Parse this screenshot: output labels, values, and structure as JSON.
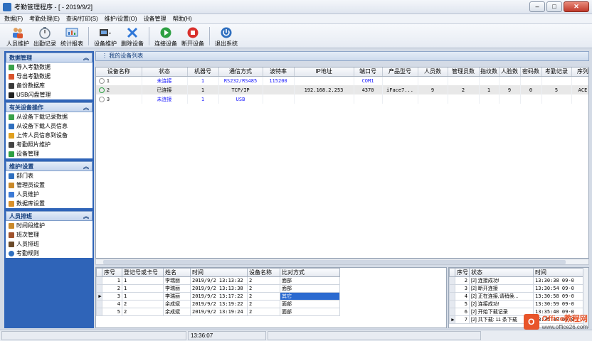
{
  "window": {
    "title": "考勤管理程序 - [ - 2019/9/2]",
    "min": "–",
    "max": "□",
    "close": "✕"
  },
  "menu": [
    "数据(F)",
    "考勤处理(E)",
    "查询/打印(S)",
    "维护/设置(O)",
    "设备管理",
    "帮助(H)"
  ],
  "toolbar": [
    {
      "label": "人员维护",
      "icon": "people-icon",
      "color": "#3c7ad6"
    },
    {
      "label": "出勤记录",
      "icon": "stopwatch-icon",
      "color": "#6b7b8c"
    },
    {
      "label": "统计报表",
      "icon": "report-icon",
      "color": "#2f6fbf"
    },
    {
      "label": "设备维护",
      "icon": "device-icon",
      "color": "#3a3a3a"
    },
    {
      "label": "删除设备",
      "icon": "delete-x-icon",
      "color": "#2f77d8"
    },
    {
      "label": "连接设备",
      "icon": "play-icon",
      "color": "#2ea043"
    },
    {
      "label": "断开设备",
      "icon": "stop-icon",
      "color": "#d9302c"
    },
    {
      "label": "退出系统",
      "icon": "power-icon",
      "color": "#2f6fbf"
    }
  ],
  "sidebar": [
    {
      "title": "数据管理",
      "items": [
        {
          "label": "导入考勤数据",
          "icon": "import-arrow-icon",
          "color": "#3aa14a"
        },
        {
          "label": "导出考勤数据",
          "icon": "export-arrow-icon",
          "color": "#d9542c"
        },
        {
          "label": "备份数据库",
          "icon": "backup-icon",
          "color": "#3a3a3a"
        },
        {
          "label": "USB闪盘管理",
          "icon": "usb-icon",
          "color": "#222"
        }
      ]
    },
    {
      "title": "有关设备操作",
      "items": [
        {
          "label": "从设备下载记录数据",
          "icon": "download-icon",
          "color": "#3aa14a"
        },
        {
          "label": "从设备下载人员信息",
          "icon": "download-people-icon",
          "color": "#2f6fbf"
        },
        {
          "label": "上传人员信息到设备",
          "icon": "upload-icon",
          "color": "#e0a020"
        },
        {
          "label": "考勤照片维护",
          "icon": "photo-icon",
          "color": "#444"
        },
        {
          "label": "设备管理",
          "icon": "device-manage-icon",
          "color": "#2ea043"
        }
      ]
    },
    {
      "title": "维护/设置",
      "items": [
        {
          "label": "部门表",
          "icon": "dept-icon",
          "color": "#2f6fbf"
        },
        {
          "label": "管理员设置",
          "icon": "admin-icon",
          "color": "#c9892a"
        },
        {
          "label": "人员维护",
          "icon": "person-icon",
          "color": "#3c7ad6"
        },
        {
          "label": "数据库设置",
          "icon": "database-icon",
          "color": "#d9902a"
        }
      ]
    },
    {
      "title": "人员排班",
      "items": [
        {
          "label": "时间段维护",
          "icon": "time-icon",
          "color": "#c9892a"
        },
        {
          "label": "班次管理",
          "icon": "shift-icon",
          "color": "#a0522d"
        },
        {
          "label": "人员排班",
          "icon": "schedule-icon",
          "color": "#6a4a2a"
        },
        {
          "label": "考勤规则",
          "icon": "rule-icon",
          "color": "#2f6fbf"
        }
      ]
    }
  ],
  "device_panel": {
    "title": "我的设备列表"
  },
  "device_table": {
    "columns": [
      "设备名称",
      "状态",
      "机器号",
      "通信方式",
      "波特率",
      "IP地址",
      "端口号",
      "产品型号",
      "人员数",
      "管理员数",
      "指纹数",
      "人脸数",
      "密码数",
      "考勤记录",
      "序列"
    ],
    "rows": [
      {
        "name": "1",
        "status": "未连接",
        "machine": "1",
        "comm": "RS232/RS485",
        "baud": "115200",
        "ip": "",
        "port": "COM1",
        "model": "",
        "users": "",
        "admins": "",
        "fp": "",
        "face": "",
        "pwd": "",
        "records": "",
        "serial": "",
        "selected": false,
        "status_color": "#1a1aff"
      },
      {
        "name": "2",
        "status": "已连接",
        "machine": "1",
        "comm": "TCP/IP",
        "baud": "",
        "ip": "192.168.2.253",
        "port": "4370",
        "model": "iFace7...",
        "users": "9",
        "admins": "2",
        "fp": "1",
        "face": "9",
        "pwd": "0",
        "records": "5",
        "serial": "ACE",
        "selected": true,
        "status_color": "#000"
      },
      {
        "name": "3",
        "status": "未连接",
        "machine": "1",
        "comm": "USB",
        "baud": "",
        "ip": "",
        "port": "",
        "model": "",
        "users": "",
        "admins": "",
        "fp": "",
        "face": "",
        "pwd": "",
        "records": "",
        "serial": "",
        "selected": false,
        "status_color": "#1a1aff"
      }
    ]
  },
  "records_table": {
    "columns": [
      "序号",
      "登记号或卡号",
      "姓名",
      "时间",
      "设备名称",
      "比对方式"
    ],
    "rows": [
      {
        "no": "1",
        "id": "1",
        "name": "李瑞丽",
        "time": "2019/9/2 13:13:32",
        "device": "2",
        "mode": "面部",
        "current": false,
        "hl": false
      },
      {
        "no": "2",
        "id": "1",
        "name": "李瑞丽",
        "time": "2019/9/2 13:13:38",
        "device": "2",
        "mode": "面部",
        "current": false,
        "hl": false
      },
      {
        "no": "3",
        "id": "1",
        "name": "李瑞丽",
        "time": "2019/9/2 13:17:22",
        "device": "2",
        "mode": "其它",
        "current": true,
        "hl": true
      },
      {
        "no": "4",
        "id": "2",
        "name": "余成斌",
        "time": "2019/9/2 13:19:22",
        "device": "2",
        "mode": "面部",
        "current": false,
        "hl": false
      },
      {
        "no": "5",
        "id": "2",
        "name": "余成斌",
        "time": "2019/9/2 13:19:24",
        "device": "2",
        "mode": "面部",
        "current": false,
        "hl": false
      }
    ]
  },
  "log_table": {
    "columns": [
      "序号",
      "状态",
      "时间"
    ],
    "rows": [
      {
        "no": "2",
        "status": "[2] 连接成功!",
        "time": "13:30:38 09-0"
      },
      {
        "no": "3",
        "status": "[2] 断开连接",
        "time": "13:30:54 09-0"
      },
      {
        "no": "4",
        "status": "[2] 正在连接,请稍侯...",
        "time": "13:30:58 09-0"
      },
      {
        "no": "5",
        "status": "[2] 连接成功!",
        "time": "13:30:59 09-0"
      },
      {
        "no": "6",
        "status": "[2] 开始下载记录",
        "time": "13:35:40 09-0"
      },
      {
        "no": "7",
        "status": "[2] 共下载: 11 条下载",
        "time": "13:35:40 09-0"
      }
    ]
  },
  "statusbar": {
    "time": "13:36:07"
  },
  "watermark": {
    "logo": "O",
    "brand": "Office教程网",
    "url": "www.office26.com"
  }
}
